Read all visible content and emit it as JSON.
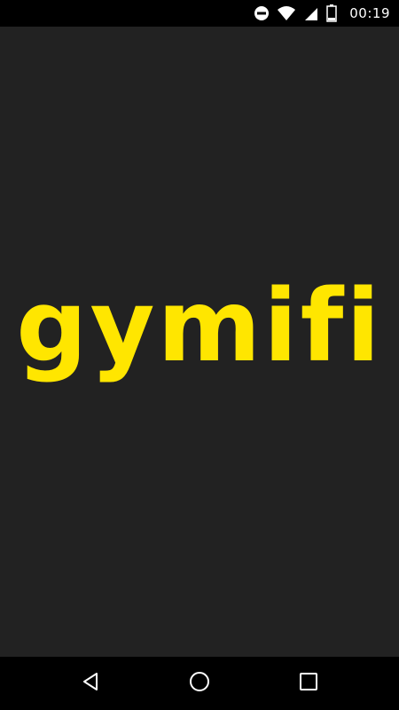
{
  "status_bar": {
    "time": "00:19",
    "icons": [
      "do-not-disturb-icon",
      "wifi-icon",
      "signal-icon",
      "battery-icon"
    ]
  },
  "splash": {
    "logo_text": "gymifi",
    "background_color": "#222222",
    "logo_color": "#FFE600"
  },
  "nav_bar": {
    "buttons": [
      "back-icon",
      "home-icon",
      "recents-icon"
    ]
  }
}
